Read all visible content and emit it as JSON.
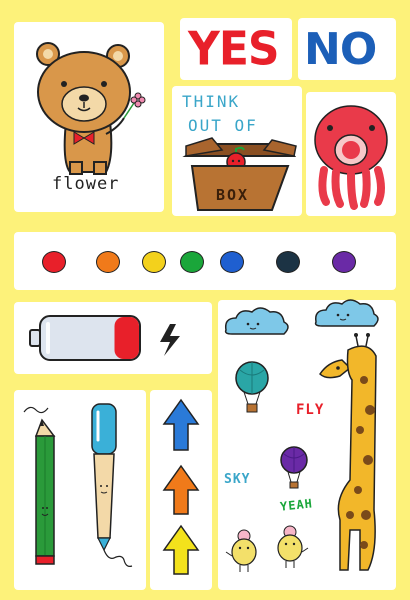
{
  "bear": {
    "caption": "flower"
  },
  "answers": {
    "yes": "YES",
    "no": "NO",
    "yes_color": "#e8202a",
    "no_color": "#1c5fb8"
  },
  "think": {
    "line1": "THINK",
    "line2": "OUT OF",
    "box_label": "BOX",
    "text_color": "#3aa6c9"
  },
  "dots": {
    "colors": [
      "#e8202a",
      "#f07a1a",
      "#f3d11c",
      "#1aa63a",
      "#1f5fd0",
      "#1c3344",
      "#6a2aa6"
    ]
  },
  "battery": {
    "level": 0.25,
    "fill_color": "#e8202a",
    "body_color": "#dde4ee"
  },
  "arrows": {
    "colors": [
      "#2a7ad8",
      "#f07a1a",
      "#f3e21c"
    ]
  },
  "sky_scene": {
    "fly_label": "FLY",
    "fly_color": "#e8202a",
    "sky_label": "SKY",
    "sky_color": "#3aa6c9",
    "yeah_label": "YEAH",
    "yeah_color": "#1aa63a"
  },
  "pens": {
    "pencil_color": "#2a9a3a",
    "marker_color": "#3ab0d8"
  }
}
